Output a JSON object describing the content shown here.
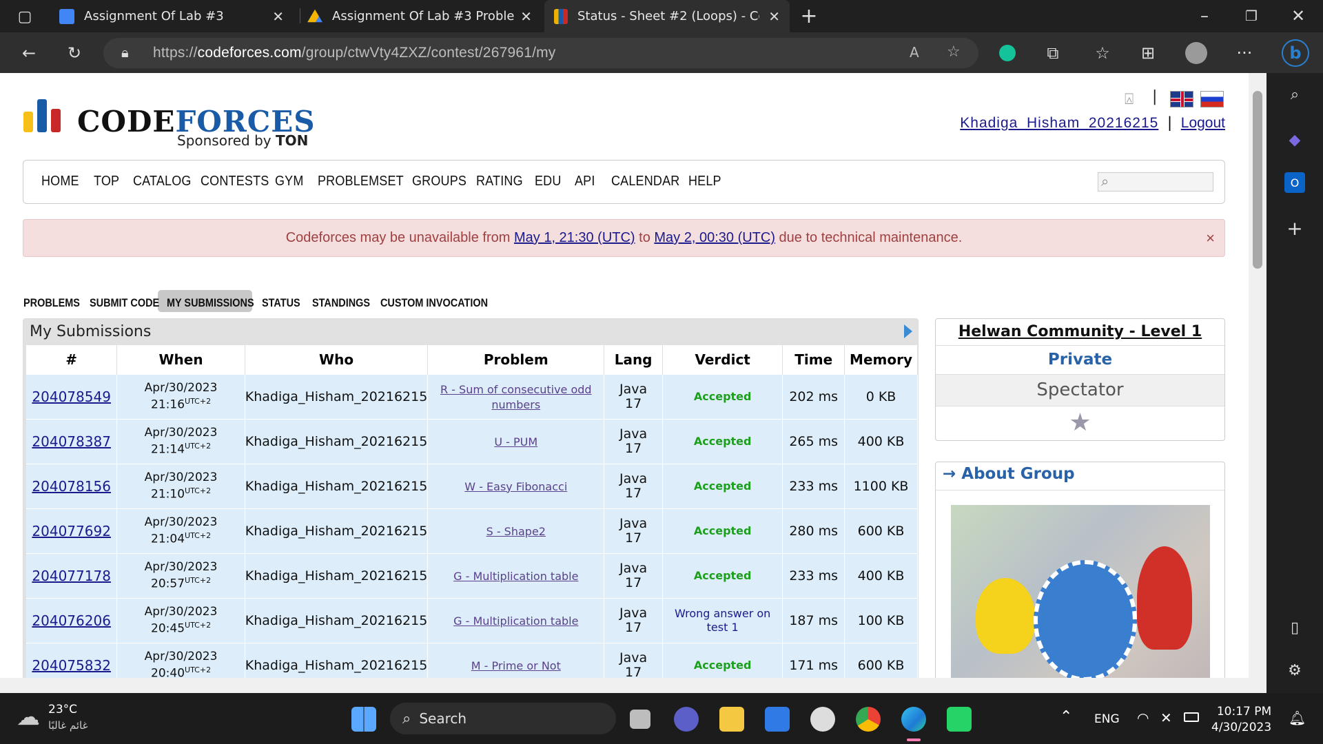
{
  "browser": {
    "tabs": [
      {
        "title": "Assignment Of Lab #3",
        "icon": "google-classroom-icon",
        "color": "#4285f4"
      },
      {
        "title": "Assignment Of Lab #3 Problems",
        "icon": "google-drive-icon",
        "color": "#34a853"
      },
      {
        "title": "Status - Sheet #2 (Loops) - Codef",
        "icon": "codeforces-icon",
        "color": "#f0b000"
      }
    ],
    "url_prefix": "https://",
    "url_domain": "codeforces.com",
    "url_path": "/group/ctwVty4ZXZ/contest/267961/my"
  },
  "site": {
    "logo_text_code": "CODE",
    "logo_text_forces": "FORCES",
    "sponsor_prefix": "Sponsored by ",
    "sponsor_name": "TON",
    "username": "Khadiga_Hisham_20216215",
    "separator": "|",
    "logout": "Logout"
  },
  "menu": [
    "HOME",
    "TOP",
    "CATALOG",
    "CONTESTS",
    "GYM",
    "PROBLEMSET",
    "GROUPS",
    "RATING",
    "EDU",
    "API",
    "CALENDAR",
    "HELP"
  ],
  "alert": {
    "prefix": "Codeforces may be unavailable from ",
    "from": "May 1, 21:30 (UTC)",
    "middle": " to ",
    "to": "May 2, 00:30 (UTC)",
    "suffix": " due to technical maintenance.",
    "close": "×"
  },
  "submenu": [
    "PROBLEMS",
    "SUBMIT CODE",
    "MY SUBMISSIONS",
    "STATUS",
    "STANDINGS",
    "CUSTOM INVOCATION"
  ],
  "submissions": {
    "title": "My Submissions",
    "headers": [
      "#",
      "When",
      "Who",
      "Problem",
      "Lang",
      "Verdict",
      "Time",
      "Memory"
    ],
    "rows": [
      {
        "id": "204078549",
        "date": "Apr/30/2023",
        "time": "21:16",
        "tz": "UTC+2",
        "who": "Khadiga_Hisham_20216215",
        "problem": "R - Sum of consecutive odd numbers",
        "lang1": "Java",
        "lang2": "17",
        "verdict": "Accepted",
        "ms": "202 ms",
        "mem": "0 KB"
      },
      {
        "id": "204078387",
        "date": "Apr/30/2023",
        "time": "21:14",
        "tz": "UTC+2",
        "who": "Khadiga_Hisham_20216215",
        "problem": "U - PUM",
        "lang1": "Java",
        "lang2": "17",
        "verdict": "Accepted",
        "ms": "265 ms",
        "mem": "400 KB"
      },
      {
        "id": "204078156",
        "date": "Apr/30/2023",
        "time": "21:10",
        "tz": "UTC+2",
        "who": "Khadiga_Hisham_20216215",
        "problem": "W - Easy Fibonacci",
        "lang1": "Java",
        "lang2": "17",
        "verdict": "Accepted",
        "ms": "233 ms",
        "mem": "1100 KB"
      },
      {
        "id": "204077692",
        "date": "Apr/30/2023",
        "time": "21:04",
        "tz": "UTC+2",
        "who": "Khadiga_Hisham_20216215",
        "problem": "S - Shape2",
        "lang1": "Java",
        "lang2": "17",
        "verdict": "Accepted",
        "ms": "280 ms",
        "mem": "600 KB"
      },
      {
        "id": "204077178",
        "date": "Apr/30/2023",
        "time": "20:57",
        "tz": "UTC+2",
        "who": "Khadiga_Hisham_20216215",
        "problem": "G - Multiplication table",
        "lang1": "Java",
        "lang2": "17",
        "verdict": "Accepted",
        "ms": "233 ms",
        "mem": "400 KB"
      },
      {
        "id": "204076206",
        "date": "Apr/30/2023",
        "time": "20:45",
        "tz": "UTC+2",
        "who": "Khadiga_Hisham_20216215",
        "problem": "G - Multiplication table",
        "lang1": "Java",
        "lang2": "17",
        "verdict": "Wrong answer on test 1",
        "ms": "187 ms",
        "mem": "100 KB"
      },
      {
        "id": "204075832",
        "date": "Apr/30/2023",
        "time": "20:40",
        "tz": "UTC+2",
        "who": "Khadiga_Hisham_20216215",
        "problem": "M - Prime or Not",
        "lang1": "Java",
        "lang2": "17",
        "verdict": "Accepted",
        "ms": "171 ms",
        "mem": "600 KB"
      }
    ]
  },
  "group": {
    "name": "Helwan Community - Level 1",
    "visibility": "Private",
    "role": "Spectator",
    "star": "★",
    "about": "→ About Group"
  },
  "taskbar": {
    "temp": "23°C",
    "weather": "غائم غالبًا",
    "search": "Search",
    "lang": "ENG",
    "time": "10:17 PM",
    "date": "4/30/2023"
  }
}
